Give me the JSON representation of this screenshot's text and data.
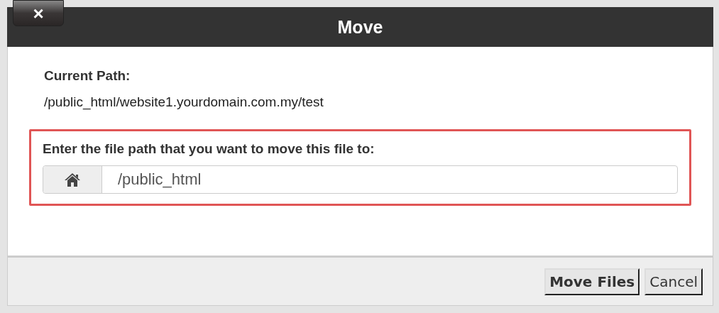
{
  "dialog": {
    "title": "Move",
    "close_label": "×"
  },
  "current_path": {
    "label": "Current Path:",
    "value": "/public_html/website1.yourdomain.com.my/test"
  },
  "destination": {
    "label": "Enter the file path that you want to move this file to:",
    "value": "/public_html",
    "highlighted": true
  },
  "buttons": [
    {
      "label": "Move Files",
      "kind": "primary"
    },
    {
      "label": "Cancel",
      "kind": "secondary"
    }
  ]
}
